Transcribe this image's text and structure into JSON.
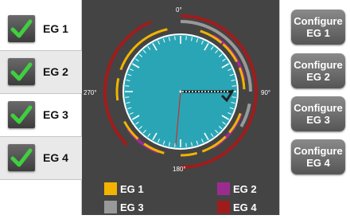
{
  "left_panel": {
    "items": [
      {
        "label": "EG 1",
        "checked": true
      },
      {
        "label": "EG 2",
        "checked": true
      },
      {
        "label": "EG 3",
        "checked": true
      },
      {
        "label": "EG 4",
        "checked": true
      }
    ]
  },
  "right_panel": {
    "buttons": [
      {
        "line1": "Configure",
        "line2": "EG 1"
      },
      {
        "line1": "Configure",
        "line2": "EG 2"
      },
      {
        "line1": "Configure",
        "line2": "EG 3"
      },
      {
        "line1": "Configure",
        "line2": "EG 4"
      }
    ]
  },
  "dial": {
    "labels": {
      "top": "0°",
      "right": "90°",
      "bottom": "180°",
      "left": "270°"
    },
    "colors": {
      "face": "#2aa5b5",
      "eg1": "#f2b400",
      "eg2": "#9b2c8f",
      "eg3": "#999999",
      "eg4": "#a01c1c"
    }
  },
  "legend": [
    {
      "label": "EG 1",
      "color": "#f2b400"
    },
    {
      "label": "EG 2",
      "color": "#9b2c8f"
    },
    {
      "label": "EG 3",
      "color": "#999999"
    },
    {
      "label": "EG 4",
      "color": "#a01c1c"
    }
  ]
}
